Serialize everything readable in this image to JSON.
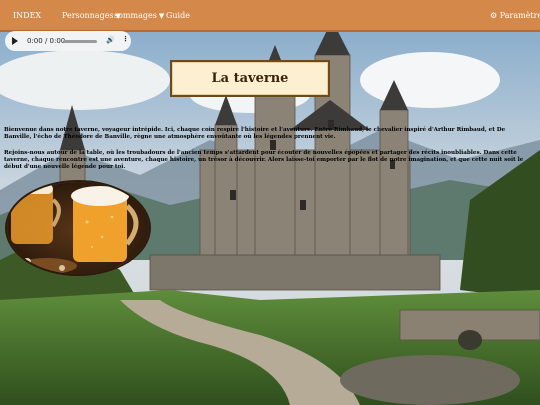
{
  "nav": {
    "index": "INDEX",
    "personnages": "Personnages",
    "sommages": "sommages",
    "guide": "Guide",
    "settings": "Paramètres",
    "settings_icon": "gear-icon"
  },
  "audio": {
    "time": "0:00 / 0:00"
  },
  "main": {
    "title": "La taverne",
    "paragraph1": "Bienvenue dans notre taverne, voyageur intrépide. Ici, chaque coin respire l'histoire et l'aventure. Entre Rimbaud, le chevalier inspiré d'Arthur Rimbaud, et De Banville, l'écho de Théodore de Banville, règne une atmosphère envoûtante où les légendes prennent vie.",
    "paragraph2": "Rejoins-nous autour de la table, où les troubadours de l'ancien temps s'attardent pour écouter de nouvelles épopées et partager des récits inoubliables. Dans cette taverne, chaque rencontre est une aventure, chaque histoire, un trésor à découvrir. Alors laisse-toi emporter par le flot de notre imagination, et que cette nuit soit le début d'une nouvelle légende pour toi."
  },
  "colors": {
    "topbar": "#d4884a",
    "title_bg": "#fdf0d0",
    "title_border": "#6b4a1e"
  }
}
